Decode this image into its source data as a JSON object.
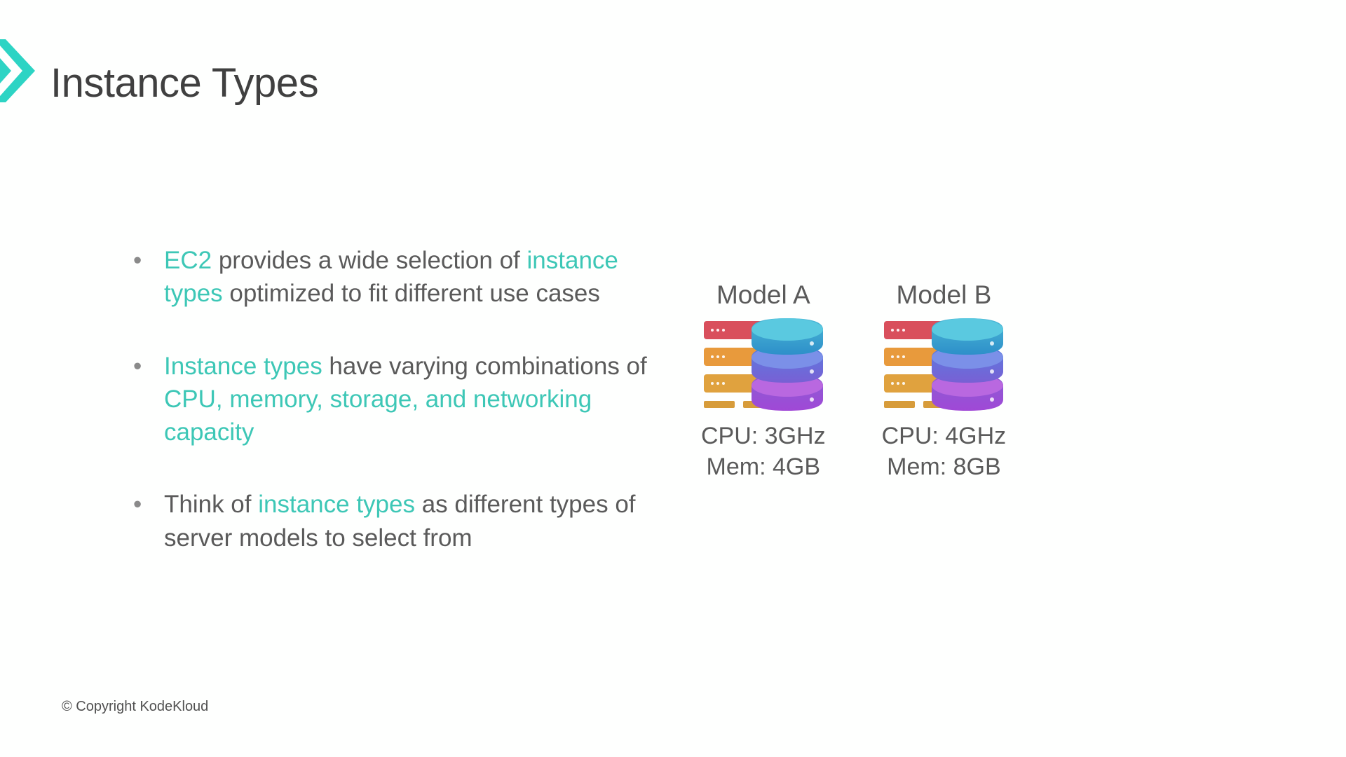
{
  "title": "Instance Types",
  "bullets": [
    {
      "segments": [
        {
          "text": "EC2",
          "highlight": true
        },
        {
          "text": " provides a wide selection of ",
          "highlight": false
        },
        {
          "text": "instance types",
          "highlight": true
        },
        {
          "text": " optimized to fit different use cases",
          "highlight": false
        }
      ]
    },
    {
      "segments": [
        {
          "text": "Instance types",
          "highlight": true
        },
        {
          "text": " have varying combinations of ",
          "highlight": false
        },
        {
          "text": "CPU, memory, storage, and networking capacity",
          "highlight": true
        }
      ]
    },
    {
      "segments": [
        {
          "text": "Think of ",
          "highlight": false
        },
        {
          "text": "instance types",
          "highlight": true
        },
        {
          "text": " as different types of server models to select from",
          "highlight": false
        }
      ]
    }
  ],
  "models": [
    {
      "name": "Model A",
      "cpu": "CPU: 3GHz",
      "mem": "Mem: 4GB"
    },
    {
      "name": "Model B",
      "cpu": "CPU: 4GHz",
      "mem": "Mem: 8GB"
    }
  ],
  "copyright": "© Copyright KodeKloud"
}
